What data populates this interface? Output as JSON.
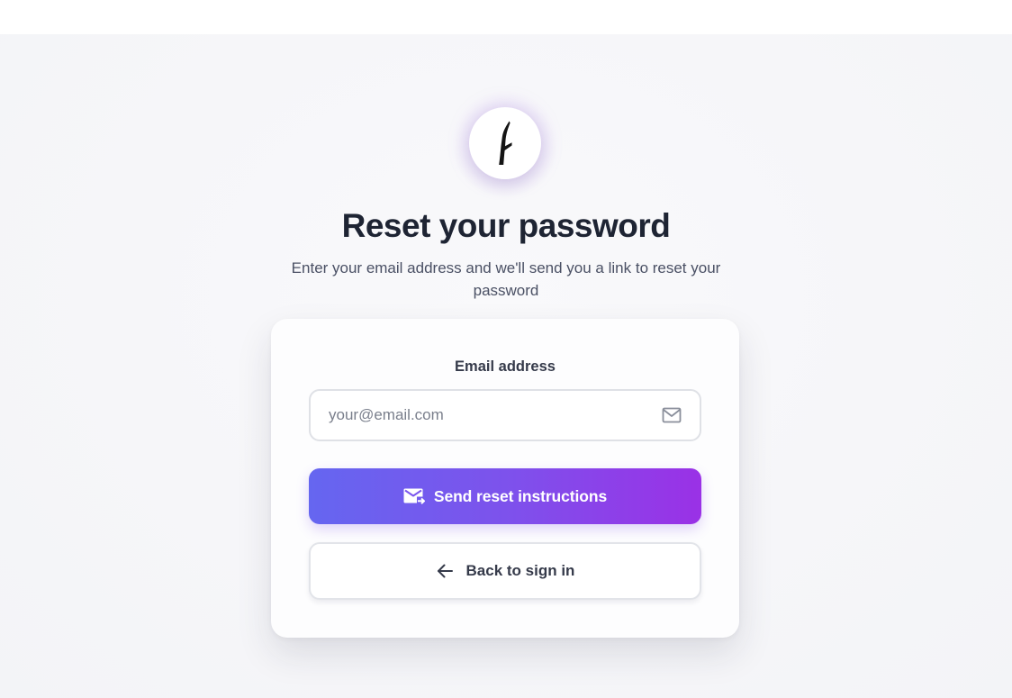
{
  "page": {
    "title": "Reset your password",
    "subtitle": "Enter your email address and we'll send you a link to reset your password"
  },
  "logo": {
    "icon": "feather-f-logo-icon"
  },
  "form": {
    "email_label": "Email address",
    "email_value": "",
    "email_placeholder": "your@email.com",
    "email_icon": "mail-icon",
    "submit_label": "Send reset instructions",
    "submit_icon": "mail-send-icon",
    "back_label": "Back to sign in",
    "back_icon": "arrow-left-icon"
  },
  "colors": {
    "title": "#1e2433",
    "gradient_start": "#6566f0",
    "gradient_end": "#9a31e6",
    "background": "#f6f6f9",
    "card": "#fdfdfe"
  }
}
